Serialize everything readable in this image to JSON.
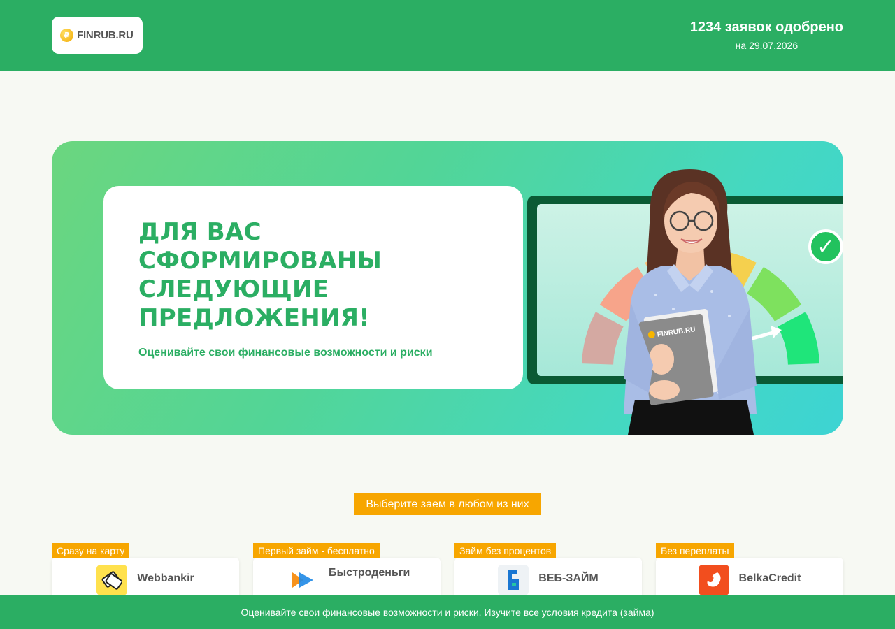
{
  "header": {
    "logo_text": "FINRUB.RU",
    "logo_coin_symbol": "₽",
    "approved_count": "1234 заявок одобрено",
    "approved_date": "на 29.07.2026"
  },
  "hero": {
    "title": "ДЛЯ ВАС\nСФОРМИРОВАНЫ\nСЛЕДУЮЩИЕ\nПРЕДЛОЖЕНИЯ!",
    "subtitle": "Оценивайте свои финансовые возможности и риски",
    "folder_label": "FINRUB.RU",
    "gauge_colors": [
      "#d4a9a2",
      "#f7a48a",
      "#fbc17b",
      "#f5d04e",
      "#7ee15e",
      "#1fe57a"
    ]
  },
  "cta": {
    "label": "Выберите заем в любом из них"
  },
  "offers": [
    {
      "tag": "Сразу на карту",
      "name": "Webbankir",
      "icon": "webbankir-logo-icon",
      "icon_bg": "#ffe14d"
    },
    {
      "tag": "Первый займ - бесплатно",
      "name": "Быстроденьги",
      "icon": "bystrodengi-logo-icon",
      "icon_bg": "#ffffff"
    },
    {
      "tag": "Займ без процентов",
      "name": "ВЕБ-ЗАЙМ",
      "icon": "web-zaim-logo-icon",
      "icon_bg": "#eef2f5"
    },
    {
      "tag": "Без переплаты",
      "name": "BelkaCredit",
      "icon": "belkacredit-logo-icon",
      "icon_bg": "#f24e1e"
    }
  ],
  "footer": {
    "text": "Оценивайте свои финансовые возможности и риски. Изучите все условия кредита (займа)"
  },
  "colors": {
    "brand_green": "#2bae63",
    "accent_orange": "#f7a600",
    "page_bg": "#f7f9f3"
  }
}
